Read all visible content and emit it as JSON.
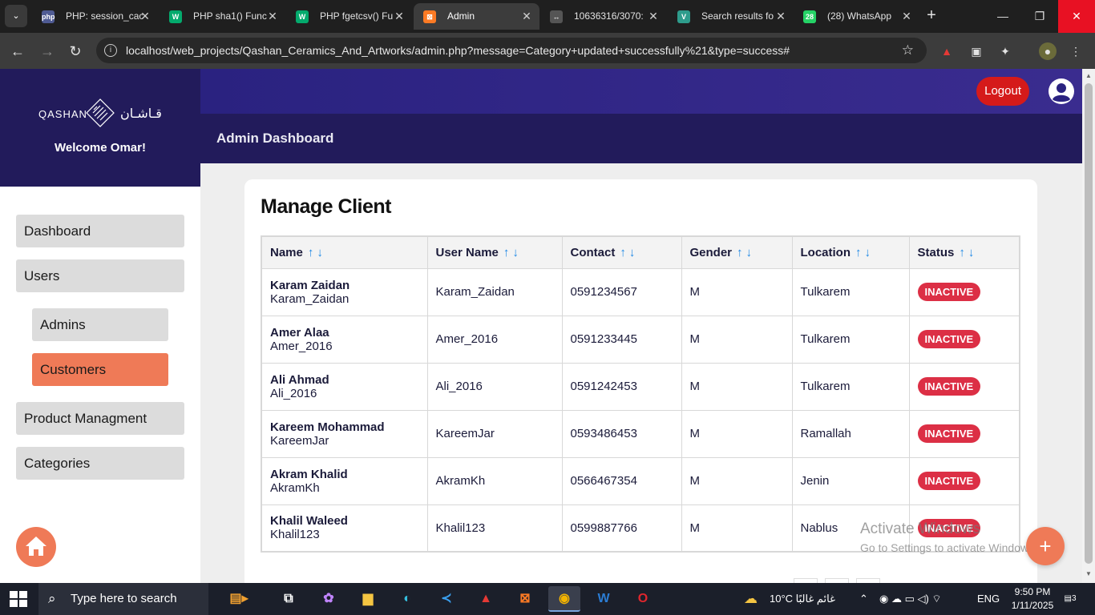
{
  "browser": {
    "tabs": [
      {
        "label": "PHP: session_cac",
        "icon": "php-icon",
        "fav_text": "php",
        "fav_color": "#4f5b93"
      },
      {
        "label": "PHP sha1() Func",
        "icon": "w3schools-icon",
        "fav_text": "W",
        "fav_color": "#04aa6d"
      },
      {
        "label": "PHP fgetcsv() Fu",
        "icon": "w3schools-icon",
        "fav_text": "W",
        "fav_color": "#04aa6d"
      },
      {
        "label": "Admin",
        "icon": "xampp-icon",
        "fav_text": "⊠",
        "fav_color": "#fb7a24",
        "active": true
      },
      {
        "label": "10636316/3070:",
        "icon": "github-icon",
        "fav_text": "↔",
        "fav_color": "#555555"
      },
      {
        "label": "Search results fo",
        "icon": "search-results-icon",
        "fav_text": "V",
        "fav_color": "#2e9c8c"
      },
      {
        "label": "(28) WhatsApp",
        "icon": "whatsapp-icon",
        "fav_text": "28",
        "fav_color": "#25d366"
      }
    ],
    "url": "localhost/web_projects/Qashan_Ceramics_And_Artworks/admin.php?message=Category+updated+successfully%21&type=success#"
  },
  "sidebar": {
    "logo_en": "QASHAN",
    "logo_ar": "قـاشـان",
    "welcome": "Welcome Omar!",
    "items": [
      {
        "label": "Dashboard"
      },
      {
        "label": "Users"
      },
      {
        "label": "Admins"
      },
      {
        "label": "Customers"
      },
      {
        "label": "Product Managment"
      },
      {
        "label": "Categories"
      }
    ]
  },
  "header": {
    "logout": "Logout",
    "title": "Admin Dashboard"
  },
  "main": {
    "heading": "Manage Client",
    "columns": [
      "Name",
      "User Name",
      "Contact",
      "Gender",
      "Location",
      "Status"
    ],
    "sort_arrows": "↑↓",
    "rows": [
      {
        "name": "Karam Zaidan",
        "username": "Karam_Zaidan",
        "contact": "0591234567",
        "gender": "M",
        "location": "Tulkarem",
        "status": "INACTIVE"
      },
      {
        "name": "Amer Alaa",
        "username": "Amer_2016",
        "contact": "0591233445",
        "gender": "M",
        "location": "Tulkarem",
        "status": "INACTIVE"
      },
      {
        "name": "Ali Ahmad",
        "username": "Ali_2016",
        "contact": "0591242453",
        "gender": "M",
        "location": "Tulkarem",
        "status": "INACTIVE"
      },
      {
        "name": "Kareem Mohammad",
        "username": "KareemJar",
        "contact": "0593486453",
        "gender": "M",
        "location": "Ramallah",
        "status": "INACTIVE"
      },
      {
        "name": "Akram Khalid",
        "username": "AkramKh",
        "contact": "0566467354",
        "gender": "M",
        "location": "Jenin",
        "status": "INACTIVE"
      },
      {
        "name": "Khalil Waleed",
        "username": "Khalil123",
        "contact": "0599887766",
        "gender": "M",
        "location": "Nablus",
        "status": "INACTIVE"
      }
    ],
    "add_button": "+"
  },
  "watermark": {
    "line1": "Activate Windows",
    "line2": "Go to Settings to activate Windows."
  },
  "taskbar": {
    "search_placeholder": "Type here to search",
    "weather": "10°C غائم غالبًا",
    "language": "ENG",
    "time": "9:50 PM",
    "date": "1/11/2025",
    "notification_count": "3"
  },
  "colors": {
    "brand_dark": "#221b5b",
    "accent": "#ef7a57",
    "logout": "#d51a1a",
    "badge_inactive": "#dc2f45"
  }
}
